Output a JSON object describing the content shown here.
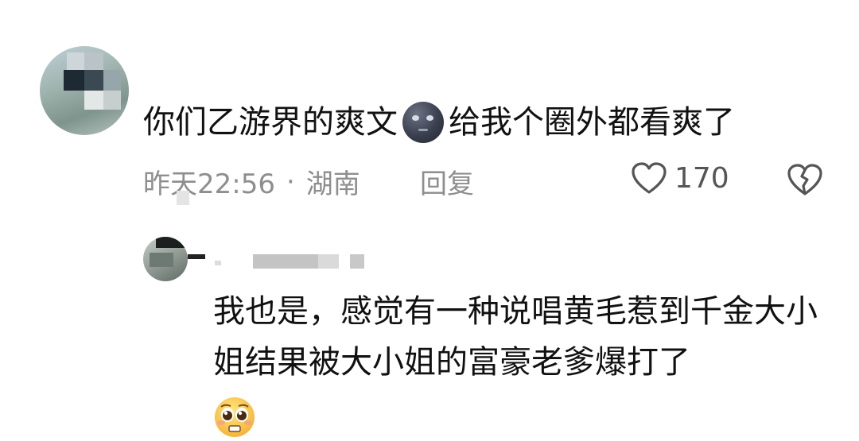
{
  "comment": {
    "text_before_emoji": "你们乙游界的爽文",
    "emoji": "new-moon-face-emoji",
    "text_after_emoji": "给我个圈外都看爽了",
    "time": "昨天22:56",
    "separator": "·",
    "location": "湖南",
    "reply_label": "回复",
    "like_count": "170"
  },
  "reply": {
    "text": "我也是，感觉有一种说唱黄毛惹到千金大小姐结果被大小姐的富豪老爹爆打了",
    "emoji": "pleading-face-emoji"
  },
  "colors": {
    "meta_text": "#8e8e8e",
    "body_text": "#111111"
  }
}
